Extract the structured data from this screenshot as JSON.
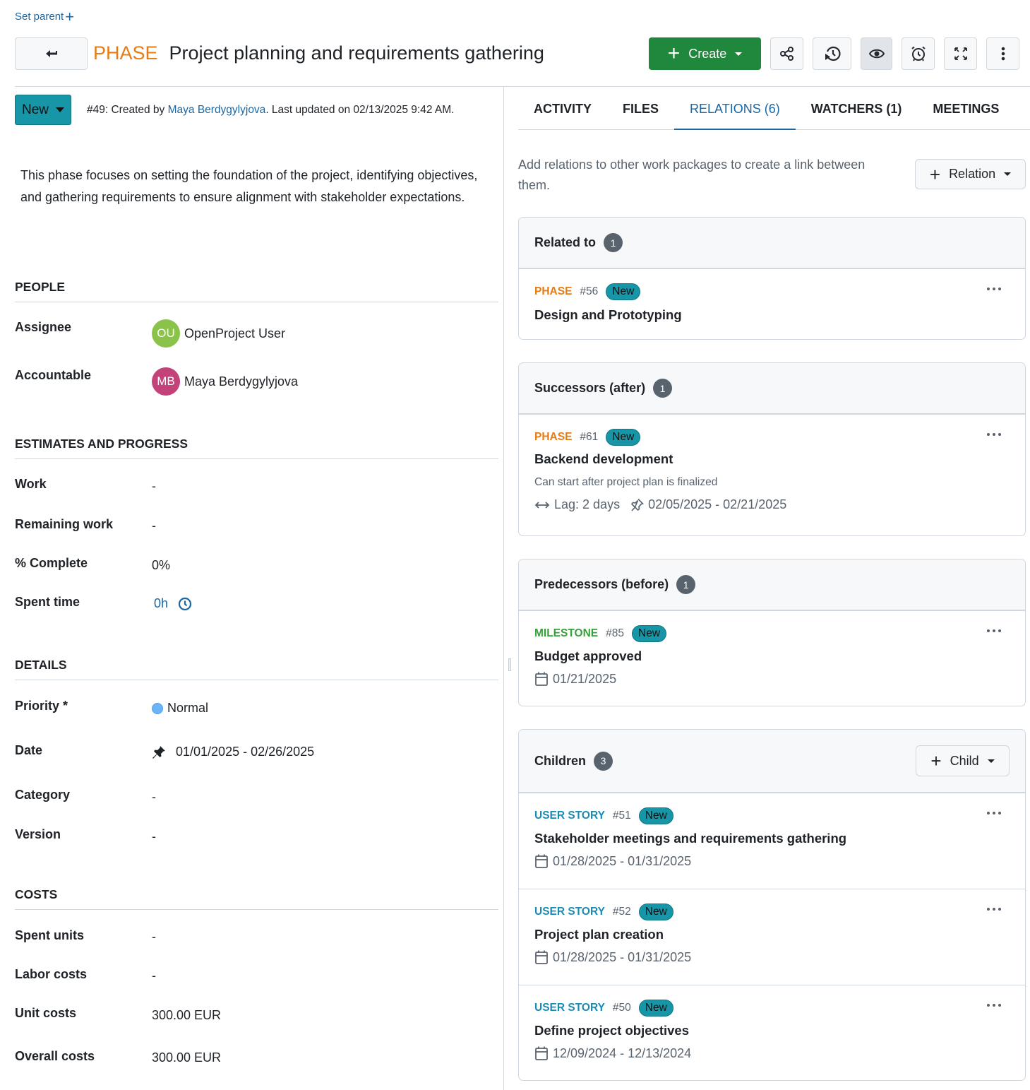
{
  "header": {
    "set_parent_label": "Set parent",
    "type": "PHASE",
    "title": "Project planning and requirements gathering",
    "create_label": "Create",
    "toolbar_icons": [
      "share-icon",
      "history-icon",
      "watch-eye-icon",
      "reminder-alarm-icon",
      "fullscreen-icon",
      "more-vertical-icon"
    ]
  },
  "status": {
    "label": "New",
    "meta_prefix": "#49: Created by ",
    "author": "Maya Berdygylyjova",
    "meta_suffix": ". Last updated on 02/13/2025 9:42 AM."
  },
  "description": "This phase focuses on setting the foundation of the project, identifying objectives, and gathering requirements to ensure alignment with stakeholder expectations.",
  "sections": {
    "people": {
      "title": "PEOPLE",
      "assignee_label": "Assignee",
      "assignee_initials": "OU",
      "assignee_name": "OpenProject User",
      "assignee_color": "#8bc34a",
      "accountable_label": "Accountable",
      "accountable_initials": "MB",
      "accountable_name": "Maya Berdygylyjova",
      "accountable_color": "#c2437a"
    },
    "estimates": {
      "title": "ESTIMATES AND PROGRESS",
      "work_label": "Work",
      "work_value": "-",
      "remaining_label": "Remaining work",
      "remaining_value": "-",
      "complete_label": "% Complete",
      "complete_value": "0%",
      "spent_label": "Spent time",
      "spent_value": "0h"
    },
    "details": {
      "title": "DETAILS",
      "priority_label": "Priority *",
      "priority_value": "Normal",
      "priority_color": "#6cb4f7",
      "date_label": "Date",
      "date_value": "01/01/2025 - 02/26/2025",
      "category_label": "Category",
      "category_value": "-",
      "version_label": "Version",
      "version_value": "-"
    },
    "costs": {
      "title": "COSTS",
      "spent_units_label": "Spent units",
      "spent_units_value": "-",
      "labor_label": "Labor costs",
      "labor_value": "-",
      "unit_label": "Unit costs",
      "unit_value": "300.00 EUR",
      "overall_label": "Overall costs",
      "overall_value": "300.00 EUR"
    }
  },
  "tabs": [
    {
      "label": "ACTIVITY"
    },
    {
      "label": "FILES"
    },
    {
      "label": "RELATIONS (6)"
    },
    {
      "label": "WATCHERS (1)"
    },
    {
      "label": "MEETINGS"
    }
  ],
  "relations": {
    "intro": "Add relations to other work packages to create a link between them.",
    "relation_button": "Relation",
    "groups": {
      "related": {
        "title": "Related to",
        "count": "1",
        "items": [
          {
            "type": "PHASE",
            "type_color": "#e67c13",
            "id": "#56",
            "status": "New",
            "title": "Design and Prototyping"
          }
        ]
      },
      "successors": {
        "title": "Successors (after)",
        "count": "1",
        "items": [
          {
            "type": "PHASE",
            "type_color": "#e67c13",
            "id": "#61",
            "status": "New",
            "title": "Backend development",
            "description": "Can start after project plan is finalized",
            "lag": "Lag: 2 days",
            "dates": "02/05/2025 - 02/21/2025"
          }
        ]
      },
      "predecessors": {
        "title": "Predecessors (before)",
        "count": "1",
        "items": [
          {
            "type": "MILESTONE",
            "type_color": "#35a13a",
            "id": "#85",
            "status": "New",
            "title": "Budget approved",
            "dates": "01/21/2025"
          }
        ]
      },
      "children": {
        "title": "Children",
        "count": "3",
        "child_button": "Child",
        "items": [
          {
            "type": "USER STORY",
            "type_color": "#1a8bb7",
            "id": "#51",
            "status": "New",
            "title": "Stakeholder meetings and requirements gathering",
            "dates": "01/28/2025 - 01/31/2025"
          },
          {
            "type": "USER STORY",
            "type_color": "#1a8bb7",
            "id": "#52",
            "status": "New",
            "title": "Project plan creation",
            "dates": "01/28/2025 - 01/31/2025"
          },
          {
            "type": "USER STORY",
            "type_color": "#1a8bb7",
            "id": "#50",
            "status": "New",
            "title": "Define project objectives",
            "dates": "12/09/2024 - 12/13/2024"
          }
        ]
      }
    }
  }
}
